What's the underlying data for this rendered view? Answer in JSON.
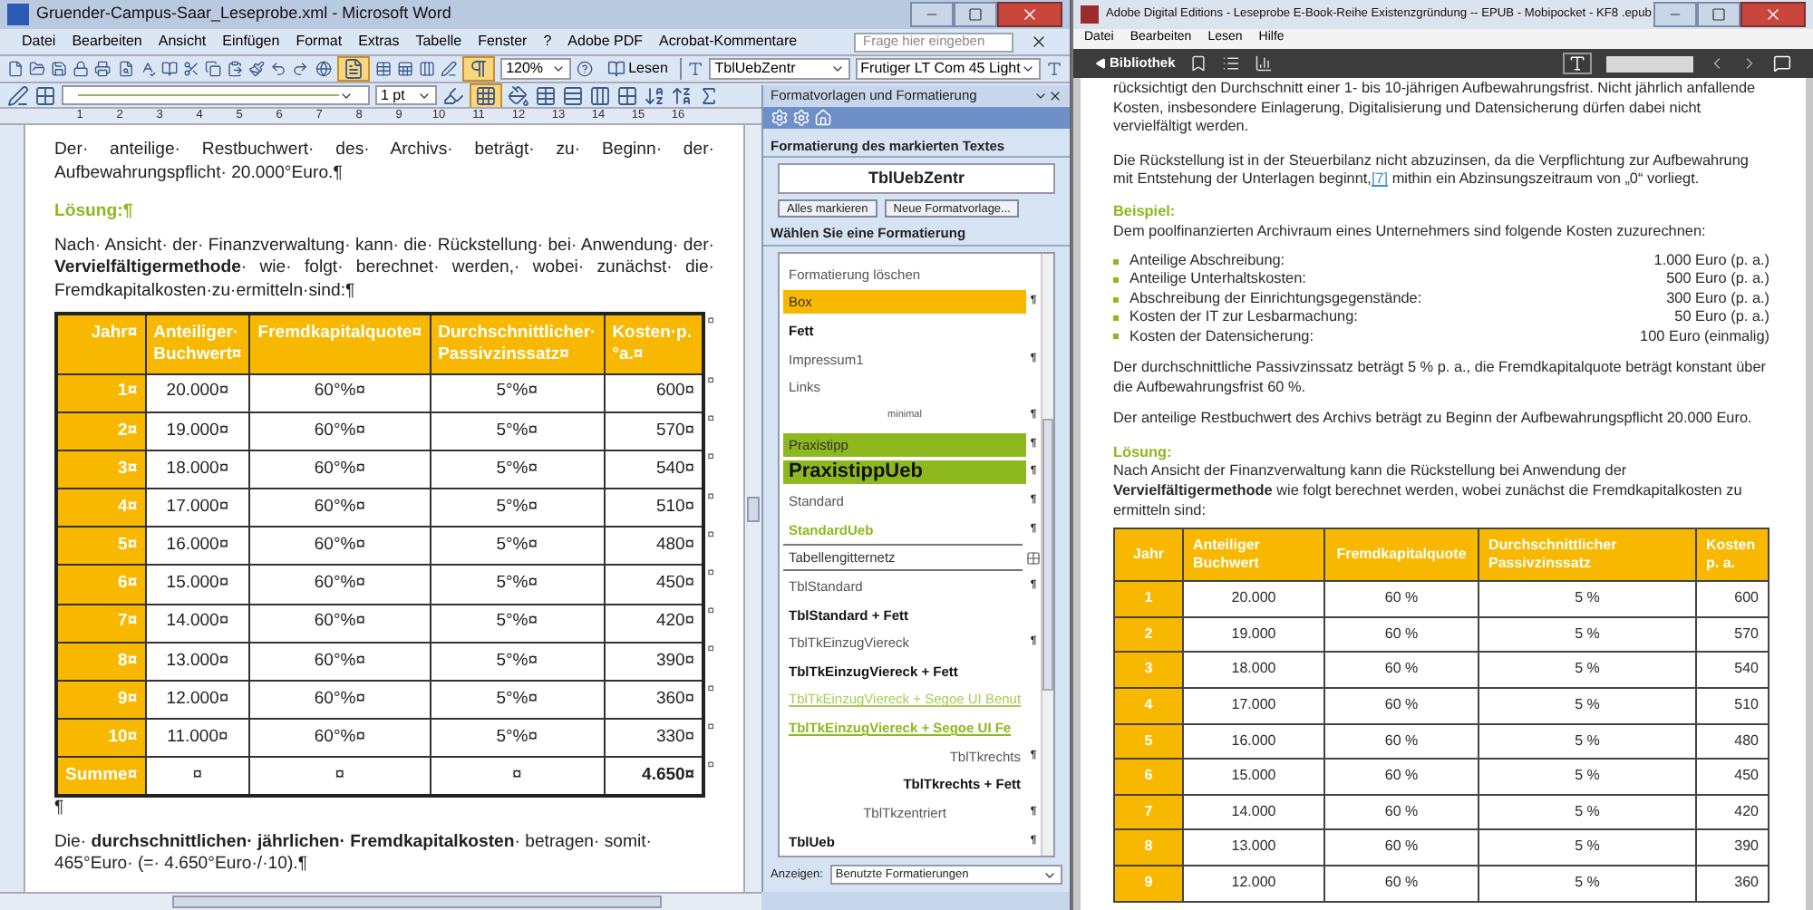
{
  "word": {
    "title": "Gruender-Campus-Saar_Leseprobe.xml - Microsoft Word",
    "menu": [
      "Datei",
      "Bearbeiten",
      "Ansicht",
      "Einfügen",
      "Format",
      "Extras",
      "Tabelle",
      "Fenster",
      "?",
      "Adobe PDF",
      "Acrobat-Kommentare"
    ],
    "help_placeholder": "Frage hier eingeben",
    "toolbar": {
      "zoom": "120%",
      "read_button": "Lesen",
      "style": "TblUebZentr",
      "font": "Frutiger LT Com 45 Light",
      "line_weight": "1 pt",
      "document_map_on": true,
      "pilcrow_on": true,
      "borders_on": true
    },
    "ruler": [
      "1",
      "2",
      "3",
      "4",
      "5",
      "6",
      "7",
      "8",
      "9",
      "10",
      "11",
      "12",
      "13",
      "14",
      "15",
      "16"
    ],
    "document": {
      "para1": "Der· anteilige· Restbuchwert· des· Archivs· beträgt· zu· Beginn· der· Aufbewahrungspflicht· 20.000°Euro.¶",
      "heading": "Lösung:¶",
      "para2": "Nach· Ansicht· der· Finanzverwaltung· kann· die· Rückstellung· bei· Anwendung· der· **Vervielfältigermethode**· wie· folgt· berechnet· werden,· wobei· zunächst· die· Fremdkapitalkosten·zu·ermitteln·sind:¶",
      "table": {
        "columns": [
          "Jahr¤",
          "Anteiliger· Buchwert¤",
          "Fremdkapitalquote¤",
          "Durchschnittlicher· Passivzinssatz¤",
          "Kosten·p.°a.¤"
        ],
        "header_end": "¤",
        "rows": [
          {
            "kind": "year",
            "cells": [
              "1¤",
              "20.000¤",
              "60°%¤",
              "5°%¤",
              "600¤"
            ],
            "end": "¤"
          },
          {
            "kind": "year",
            "cells": [
              "2¤",
              "19.000¤",
              "60°%¤",
              "5°%¤",
              "570¤"
            ],
            "end": "¤"
          },
          {
            "kind": "year",
            "cells": [
              "3¤",
              "18.000¤",
              "60°%¤",
              "5°%¤",
              "540¤"
            ],
            "end": "¤"
          },
          {
            "kind": "year",
            "cells": [
              "4¤",
              "17.000¤",
              "60°%¤",
              "5°%¤",
              "510¤"
            ],
            "end": "¤"
          },
          {
            "kind": "year",
            "cells": [
              "5¤",
              "16.000¤",
              "60°%¤",
              "5°%¤",
              "480¤"
            ],
            "end": "¤"
          },
          {
            "kind": "year",
            "cells": [
              "6¤",
              "15.000¤",
              "60°%¤",
              "5°%¤",
              "450¤"
            ],
            "end": "¤"
          },
          {
            "kind": "year",
            "cells": [
              "7¤",
              "14.000¤",
              "60°%¤",
              "5°%¤",
              "420¤"
            ],
            "end": "¤"
          },
          {
            "kind": "year",
            "cells": [
              "8¤",
              "13.000¤",
              "60°%¤",
              "5°%¤",
              "390¤"
            ],
            "end": "¤"
          },
          {
            "kind": "year",
            "cells": [
              "9¤",
              "12.000¤",
              "60°%¤",
              "5°%¤",
              "360¤"
            ],
            "end": "¤"
          },
          {
            "kind": "year",
            "cells": [
              "10¤",
              "11.000¤",
              "60°%¤",
              "5°%¤",
              "330¤"
            ],
            "end": "¤"
          },
          {
            "kind": "total",
            "cells": [
              "Summe¤",
              "¤",
              "¤",
              "¤",
              "4.650¤"
            ],
            "end": "¤"
          }
        ]
      },
      "after_table": "¶",
      "para3": "Die· **durchschnittlichen· jährlichen· Fremdkapitalkosten**· betragen· somit· 465°Euro· (=· 4.650°Euro·/·10).¶"
    },
    "pane": {
      "title": "Formatvorlagen und Formatierung",
      "current_label": "Formatierung des markierten Textes",
      "current_style": "TblUebZentr",
      "buttons": [
        "Alles markieren",
        "Neue Formatvorlage..."
      ],
      "choose_label": "Wählen Sie eine Formatierung",
      "styles": [
        {
          "label": "Formatierung löschen",
          "kind": "plain"
        },
        {
          "label": "Box",
          "kind": "highlight",
          "color": "#f9b800",
          "mark": "¶"
        },
        {
          "label": "Fett",
          "kind": "bold"
        },
        {
          "label": "Impressum1",
          "kind": "plain",
          "mark": "¶"
        },
        {
          "label": "Links",
          "kind": "plain"
        },
        {
          "label": "minimal",
          "kind": "tiny",
          "mark": "¶"
        },
        {
          "label": "Praxistipp",
          "kind": "highlight",
          "color": "#8db81e",
          "mark": "¶"
        },
        {
          "label": "PraxistippUeb",
          "kind": "highlight-heading",
          "color": "#8db81e",
          "mark": "¶"
        },
        {
          "label": "Standard",
          "kind": "plain",
          "mark": "¶"
        },
        {
          "label": "StandardUeb",
          "kind": "green",
          "mark": "¶"
        },
        {
          "label": "Tabellengitternetz",
          "kind": "table"
        },
        {
          "label": "TblStandard",
          "kind": "plain",
          "mark": "¶"
        },
        {
          "label": "TblStandard + Fett",
          "kind": "bold"
        },
        {
          "label": "TblTkEinzugViereck",
          "kind": "plain",
          "mark": "¶"
        },
        {
          "label": "TblTkEinzugViereck + Fett",
          "kind": "bold"
        },
        {
          "label": "TblTkEinzugViereck + Segoe UI Benut",
          "kind": "link"
        },
        {
          "label": "TblTkEinzugViereck + Segoe UI Fe",
          "kind": "link-bold"
        },
        {
          "label": "TblTkrechts",
          "kind": "right",
          "mark": "¶"
        },
        {
          "label": "TblTkrechts + Fett",
          "kind": "right-bold"
        },
        {
          "label": "TblTkzentriert",
          "kind": "center",
          "mark": "¶"
        },
        {
          "label": "TblUeb",
          "kind": "bold",
          "mark": "¶"
        }
      ],
      "show_label": "Anzeigen:",
      "show_value": "Benutzte Formatierungen"
    }
  },
  "reader": {
    "title": "Adobe Digital Editions - Leseprobe E-Book-Reihe Existenzgründung -- EPUB - Mobipocket - KF8 .epub",
    "menu": [
      "Datei",
      "Bearbeiten",
      "Lesen",
      "Hilfe"
    ],
    "library_button": "Bibliothek",
    "para1": "rücksichtigt den Durchschnitt einer 1- bis 10-jährigen Aufbewahrungsfrist. Nicht jährlich anfallende Kosten, insbesondere Einlagerung, Digitalisierung und Datensicherung dürfen dabei nicht vervielfältigt werden.",
    "para2_before": "Die Rückstellung ist in der Steuerbilanz nicht abzuzinsen, da die Verpflichtung zur Aufbewahrung mit Entstehung der Unterlagen beginnt,",
    "para2_link": "[7]",
    "para2_after": " mithin ein Abzinsungszeitraum von „0“ vorliegt.",
    "heading1": "Beispiel:",
    "para3": "Dem poolfinanzierten Archivraum eines Unternehmers sind folgende Kosten zuzurechnen:",
    "costs": [
      {
        "label": "Anteilige Abschreibung:",
        "value": "1.000 Euro (p. a.)"
      },
      {
        "label": "Anteilige Unterhaltskosten:",
        "value": "500 Euro (p. a.)"
      },
      {
        "label": "Abschreibung der Einrichtungsgegenstände:",
        "value": "300 Euro (p. a.)"
      },
      {
        "label": "Kosten der IT zur Lesbarmachung:",
        "value": "50 Euro (p. a.)"
      },
      {
        "label": "Kosten der Datensicherung:",
        "value": "100 Euro (einmalig)"
      }
    ],
    "para4": "Der durchschnittliche Passivzinssatz beträgt 5 % p. a., die Fremdkapitalquote beträgt konstant über die Aufbewahrungsfrist 60 %.",
    "para5": "Der anteilige Restbuchwert des Archivs beträgt zu Beginn der Aufbewahrungspflicht 20.000 Euro.",
    "heading2": "Lösung:",
    "para6": "Nach Ansicht der Finanzverwaltung kann die Rückstellung bei Anwendung der **Vervielfältigermethode** wie folgt berechnet werden, wobei zunächst die Fremdkapitalkosten zu ermitteln sind:",
    "table": {
      "columns": [
        "Jahr",
        "Anteiliger Buchwert",
        "Fremdkapitalquote",
        "Durchschnittlicher Passivzinssatz",
        "Kosten p. a."
      ],
      "rows": [
        [
          "1",
          "20.000",
          "60 %",
          "5 %",
          "600"
        ],
        [
          "2",
          "19.000",
          "60 %",
          "5 %",
          "570"
        ],
        [
          "3",
          "18.000",
          "60 %",
          "5 %",
          "540"
        ],
        [
          "4",
          "17.000",
          "60 %",
          "5 %",
          "510"
        ],
        [
          "5",
          "16.000",
          "60 %",
          "5 %",
          "480"
        ],
        [
          "6",
          "15.000",
          "60 %",
          "5 %",
          "450"
        ],
        [
          "7",
          "14.000",
          "60 %",
          "5 %",
          "420"
        ],
        [
          "8",
          "13.000",
          "60 %",
          "5 %",
          "390"
        ],
        [
          "9",
          "12.000",
          "60 %",
          "5 %",
          "360"
        ]
      ]
    }
  }
}
